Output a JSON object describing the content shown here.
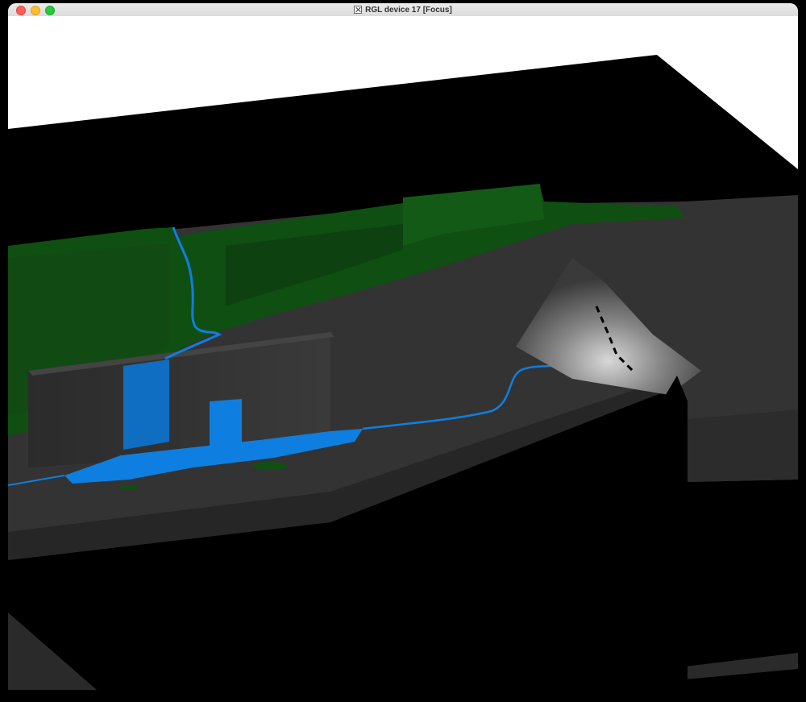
{
  "window": {
    "title": "RGL device 17 [Focus]",
    "app_icon": "x11-icon",
    "controls": [
      "close-button",
      "minimize-button",
      "zoom-button"
    ]
  },
  "scene": {
    "type": "rgl-3d-terrain",
    "colors": {
      "background": "#ffffff",
      "base": "#000000",
      "terrain": "#333333",
      "forest": "#0f4f12",
      "water": "#0e7fe0",
      "peak_highlight": "#cfcfcf",
      "path": "#000000"
    },
    "layers": [
      "terrain-surface",
      "forest-overlay",
      "river",
      "lake",
      "waterfall",
      "trail-path",
      "mountain-peak"
    ]
  }
}
